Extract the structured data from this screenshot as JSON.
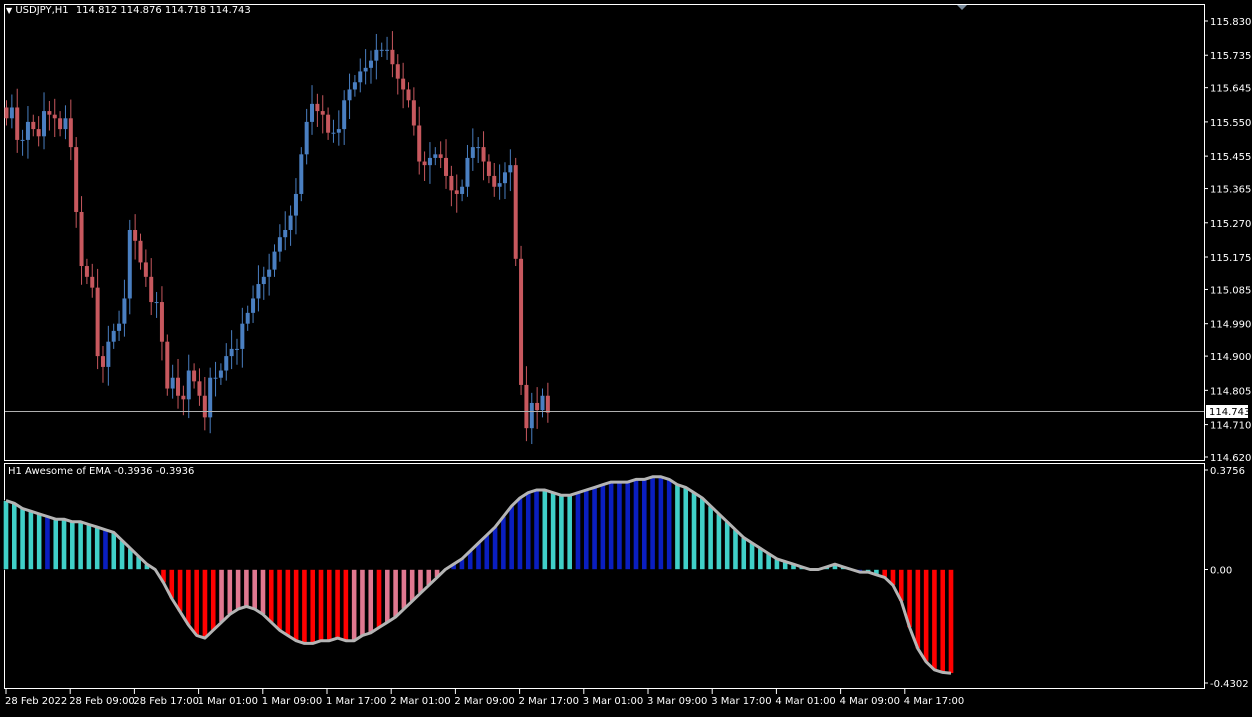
{
  "header": {
    "symbol_title": "USDJPY,H1",
    "ohlc": "114.812 114.876 114.718 114.743"
  },
  "indicator": {
    "title": "H1 Awesome of EMA",
    "values": "-0.3936 -0.3936"
  },
  "colors": {
    "background": "#000000",
    "grid_frame": "#ffffff",
    "bull_candle": "#4a7fc1",
    "bear_candle": "#c7585e",
    "hist_cyan": "#40d0c8",
    "hist_blue": "#0a1ec0",
    "hist_red": "#ff0000",
    "hist_pink": "#e07890",
    "osc_line": "#b4b4b4"
  },
  "chart_data": [
    {
      "type": "candlestick",
      "title": "USDJPY,H1",
      "ylim": [
        114.62,
        115.86
      ],
      "y_ticks": [
        "115.830",
        "115.735",
        "115.645",
        "115.550",
        "115.455",
        "115.365",
        "115.270",
        "115.175",
        "115.085",
        "114.990",
        "114.900",
        "114.805",
        "114.710",
        "114.620"
      ],
      "current_price": "114.743",
      "x_ticks": [
        "28 Feb 2022",
        "28 Feb 09:00",
        "28 Feb 17:00",
        "1 Mar 01:00",
        "1 Mar 09:00",
        "1 Mar 17:00",
        "2 Mar 01:00",
        "2 Mar 09:00",
        "2 Mar 17:00",
        "3 Mar 01:00",
        "3 Mar 09:00",
        "3 Mar 17:00",
        "4 Mar 01:00",
        "4 Mar 09:00",
        "4 Mar 17:00"
      ],
      "close_path": [
        115.56,
        115.59,
        115.5,
        115.5,
        115.55,
        115.53,
        115.51,
        115.58,
        115.57,
        115.56,
        115.53,
        115.56,
        115.48,
        115.3,
        115.15,
        115.12,
        115.09,
        114.9,
        114.87,
        114.94,
        114.97,
        114.99,
        115.06,
        115.25,
        115.22,
        115.16,
        115.12,
        115.05,
        115.05,
        114.94,
        114.81,
        114.84,
        114.79,
        114.78,
        114.86,
        114.83,
        114.79,
        114.73,
        114.84,
        114.84,
        114.86,
        114.9,
        114.92,
        114.92,
        114.99,
        115.02,
        115.06,
        115.1,
        115.12,
        115.14,
        115.19,
        115.23,
        115.25,
        115.29,
        115.35,
        115.46,
        115.55,
        115.6,
        115.58,
        115.57,
        115.52,
        115.52,
        115.53,
        115.61,
        115.64,
        115.66,
        115.69,
        115.7,
        115.72,
        115.75,
        115.75,
        115.75,
        115.71,
        115.67,
        115.64,
        115.61,
        115.54,
        115.44,
        115.43,
        115.45,
        115.46,
        115.45,
        115.4,
        115.36,
        115.35,
        115.37,
        115.45,
        115.48,
        115.48,
        115.44,
        115.4,
        115.37,
        115.38,
        115.41,
        115.43,
        115.17,
        114.82,
        114.7,
        114.77,
        114.75,
        114.79,
        114.743
      ]
    },
    {
      "type": "bar",
      "title": "H1 Awesome of EMA",
      "ylim": [
        -0.4302,
        0.3756
      ],
      "y_ticks": [
        "0.3756",
        "0.00",
        "-0.4302"
      ],
      "values": [
        0.26,
        0.25,
        0.23,
        0.22,
        0.21,
        0.2,
        0.19,
        0.19,
        0.18,
        0.18,
        0.17,
        0.16,
        0.15,
        0.14,
        0.11,
        0.08,
        0.05,
        0.02,
        0.0,
        -0.05,
        -0.11,
        -0.16,
        -0.21,
        -0.25,
        -0.26,
        -0.23,
        -0.2,
        -0.17,
        -0.15,
        -0.14,
        -0.15,
        -0.17,
        -0.2,
        -0.23,
        -0.25,
        -0.27,
        -0.28,
        -0.28,
        -0.27,
        -0.27,
        -0.26,
        -0.27,
        -0.27,
        -0.25,
        -0.24,
        -0.22,
        -0.2,
        -0.18,
        -0.15,
        -0.12,
        -0.09,
        -0.06,
        -0.03,
        0.0,
        0.02,
        0.04,
        0.07,
        0.1,
        0.13,
        0.16,
        0.2,
        0.24,
        0.27,
        0.29,
        0.3,
        0.3,
        0.29,
        0.28,
        0.28,
        0.29,
        0.3,
        0.31,
        0.32,
        0.33,
        0.33,
        0.33,
        0.34,
        0.34,
        0.35,
        0.35,
        0.34,
        0.32,
        0.31,
        0.29,
        0.27,
        0.24,
        0.21,
        0.18,
        0.15,
        0.12,
        0.1,
        0.08,
        0.06,
        0.04,
        0.03,
        0.02,
        0.01,
        0.0,
        0.0,
        0.01,
        0.02,
        0.01,
        0.0,
        -0.01,
        -0.01,
        -0.02,
        -0.03,
        -0.06,
        -0.12,
        -0.22,
        -0.3,
        -0.35,
        -0.38,
        -0.39,
        -0.3936
      ],
      "colors": [
        "c",
        "c",
        "c",
        "c",
        "c",
        "b",
        "c",
        "c",
        "c",
        "c",
        "c",
        "c",
        "b",
        "c",
        "c",
        "c",
        "c",
        "c",
        "c",
        "r",
        "r",
        "r",
        "r",
        "r",
        "r",
        "r",
        "p",
        "p",
        "p",
        "p",
        "p",
        "p",
        "r",
        "r",
        "r",
        "r",
        "r",
        "r",
        "r",
        "r",
        "r",
        "r",
        "p",
        "p",
        "p",
        "r",
        "p",
        "p",
        "p",
        "p",
        "p",
        "p",
        "p",
        "p",
        "b",
        "b",
        "b",
        "b",
        "b",
        "b",
        "b",
        "b",
        "b",
        "b",
        "b",
        "c",
        "c",
        "c",
        "c",
        "b",
        "b",
        "b",
        "b",
        "b",
        "b",
        "b",
        "b",
        "b",
        "b",
        "b",
        "b",
        "c",
        "c",
        "c",
        "c",
        "c",
        "c",
        "c",
        "c",
        "c",
        "c",
        "c",
        "c",
        "c",
        "c",
        "c",
        "c",
        "c",
        "c",
        "c",
        "c",
        "c",
        "b",
        "b",
        "c",
        "c",
        "r",
        "r",
        "r",
        "r",
        "r",
        "r",
        "r",
        "r",
        "r",
        "r",
        "r",
        "r"
      ]
    }
  ]
}
